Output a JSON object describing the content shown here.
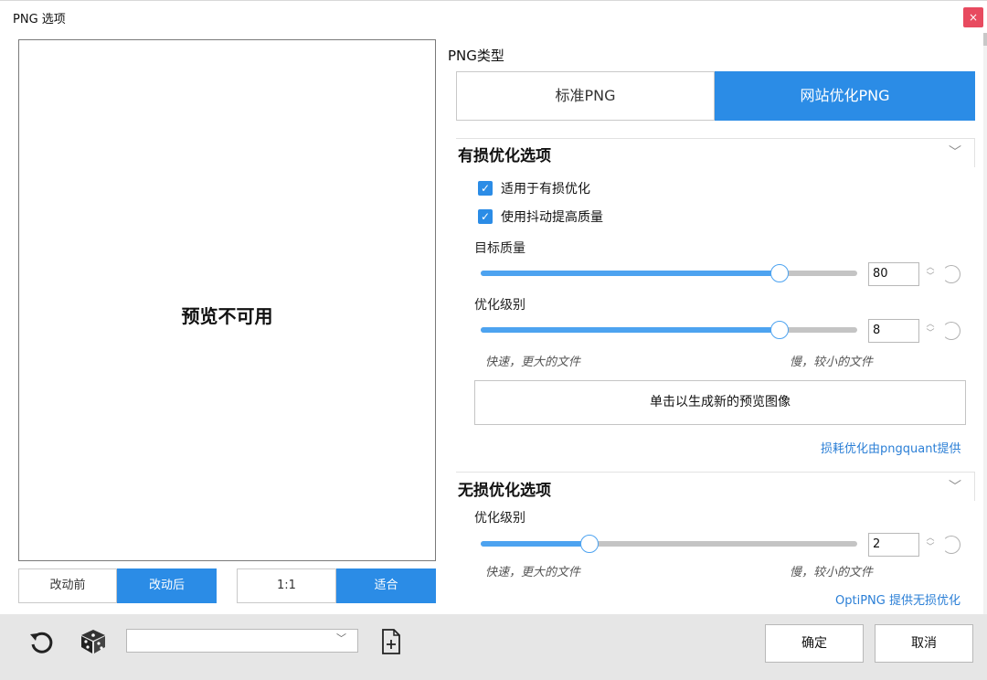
{
  "window": {
    "title": "PNG 选项",
    "close_label": "×"
  },
  "preview": {
    "message": "预览不可用",
    "view_toggle": [
      "改动前",
      "改动后"
    ],
    "zoom_toggle": [
      "1:1",
      "适合"
    ]
  },
  "png_type": {
    "label": "PNG类型",
    "options": [
      "标准PNG",
      "网站优化PNG"
    ],
    "selected": "网站优化PNG"
  },
  "lossy": {
    "title": "有损优化选项",
    "checkbox_1": "适用于有损优化",
    "checkbox_2": "使用抖动提高质量",
    "quality_label": "目标质量",
    "quality_value": "80",
    "level_label": "优化级别",
    "level_value": "8",
    "hint_left": "快速，更大的文件",
    "hint_right": "慢，较小的文件",
    "generate_button": "单击以生成新的预览图像",
    "credit": "损耗优化由pngquant提供"
  },
  "lossless": {
    "title": "无损优化选项",
    "level_label": "优化级别",
    "level_value": "2",
    "hint_left": "快速，更大的文件",
    "hint_right": "慢，较小的文件",
    "credit": "OptiPNG 提供无损优化"
  },
  "footer": {
    "ok": "确定",
    "cancel": "取消",
    "combo_value": ""
  },
  "colors": {
    "accent": "#2b8ce6",
    "close": "#e84a5f",
    "footer_bg": "#e6e6e6"
  },
  "icons": [
    "reset-icon",
    "dice-icon",
    "chevron-down-icon",
    "add-file-icon",
    "spin-up-down-icon",
    "reset-value-icon"
  ]
}
